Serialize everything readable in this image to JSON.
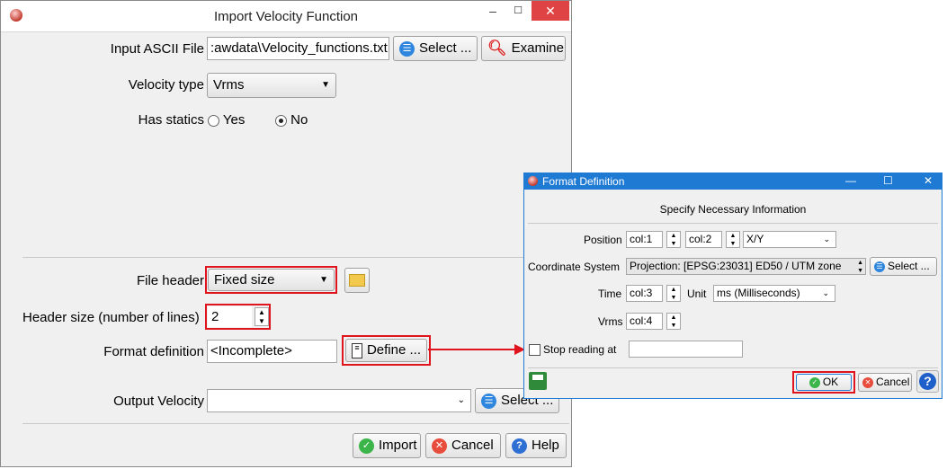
{
  "main_dialog": {
    "title": "Import Velocity Function",
    "controls": {
      "minimize": "–",
      "maximize": "☐",
      "close": "✕"
    },
    "input_ascii_label": "Input ASCII File",
    "input_ascii_value": ":awdata\\Velocity_functions.txt",
    "select_label": "Select ...",
    "examine_label": "Examine",
    "velocity_type_label": "Velocity type",
    "velocity_type_value": "Vrms",
    "has_statics_label": "Has statics",
    "yes_label": "Yes",
    "no_label": "No",
    "has_statics_selected": "No",
    "file_header_label": "File header",
    "file_header_value": "Fixed size",
    "header_size_label": "Header size (number of lines)",
    "header_size_value": "2",
    "format_definition_label": "Format definition",
    "format_definition_value": "<Incomplete>",
    "define_label": "Define ...",
    "output_velocity_label": "Output Velocity",
    "output_velocity_value": "",
    "output_select_label": "Select ...",
    "import_label": "Import",
    "cancel_label": "Cancel",
    "help_label": "Help"
  },
  "format_dialog": {
    "title": "Format Definition",
    "controls": {
      "minimize": "—",
      "maximize": "☐",
      "close": "✕"
    },
    "heading": "Specify Necessary Information",
    "position_label": "Position",
    "position_col1": "col:1",
    "position_col2": "col:2",
    "position_type": "X/Y",
    "coord_system_label": "Coordinate System",
    "coord_system_value": "Projection: [EPSG:23031] ED50 / UTM zone",
    "coord_select_label": "Select ...",
    "time_label": "Time",
    "time_col": "col:3",
    "unit_label": "Unit",
    "unit_value": "ms (Milliseconds)",
    "vrms_label": "Vrms",
    "vrms_col": "col:4",
    "stop_reading_label": "Stop reading at",
    "stop_reading_value": "",
    "ok_label": "OK",
    "cancel_label": "Cancel",
    "help_symbol": "?"
  },
  "colors": {
    "highlight_red": "#e0141e",
    "title_blue": "#1f7ad4",
    "ok_green": "#3bb54a",
    "cancel_red": "#e74c3c",
    "select_blue": "#2e86de"
  }
}
